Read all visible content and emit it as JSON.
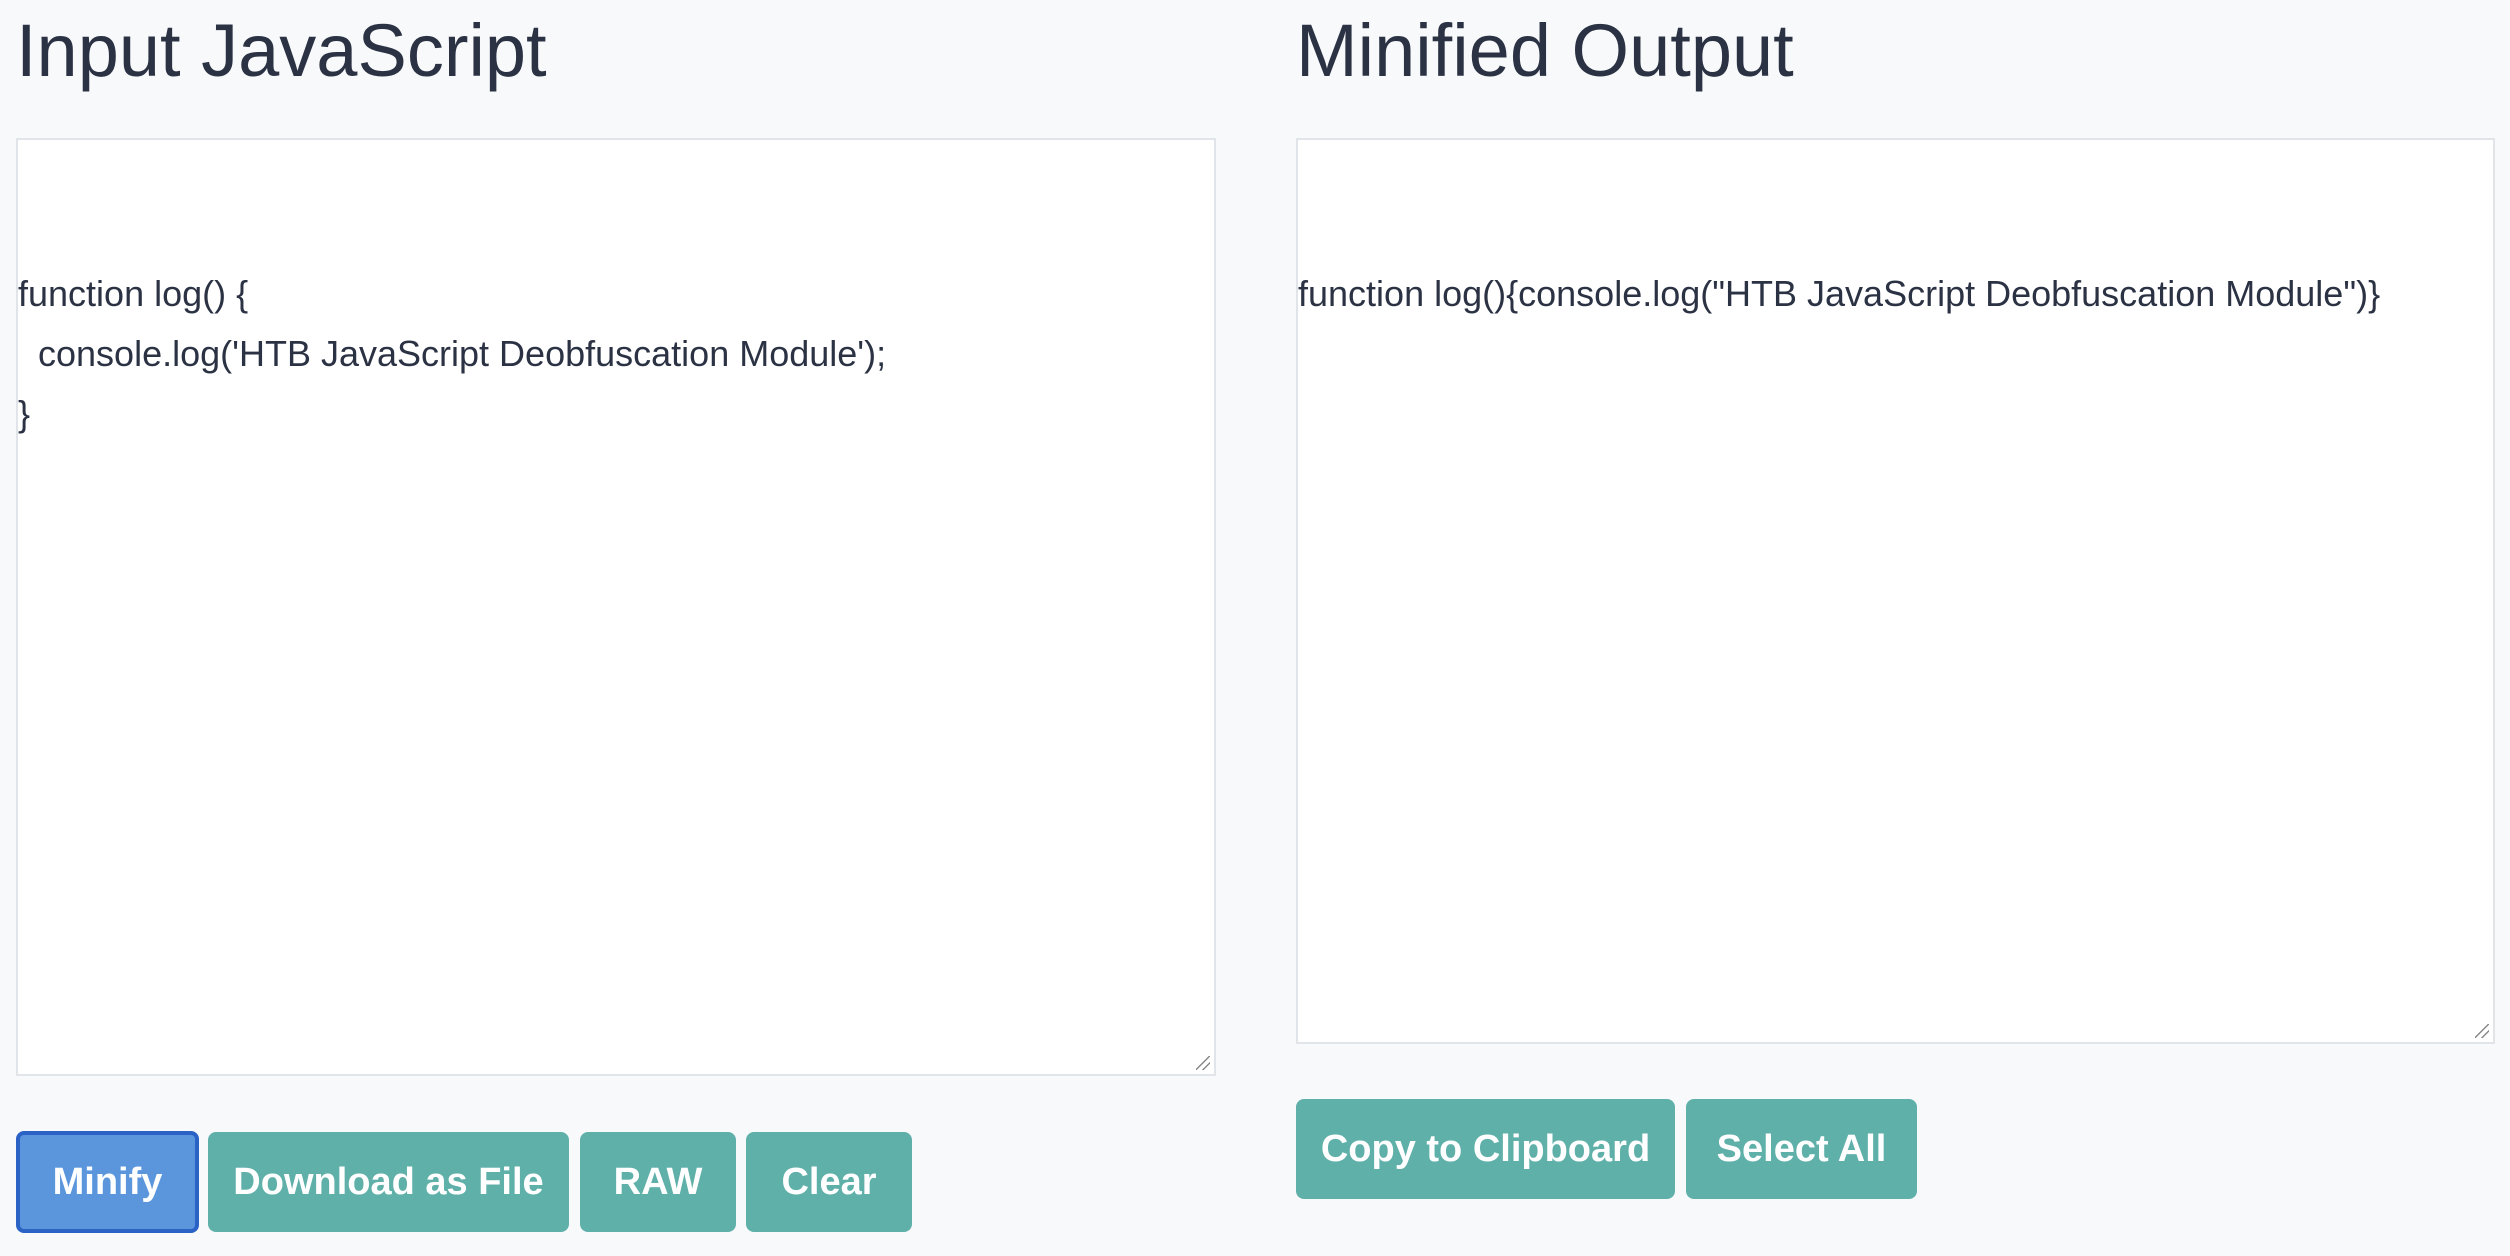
{
  "input": {
    "title": "Input JavaScript",
    "code": "function log() {\n  console.log('HTB JavaScript Deobfuscation Module');\n}",
    "buttons": {
      "minify": "Minify",
      "download": "Download as File",
      "raw": "RAW",
      "clear": "Clear"
    }
  },
  "output": {
    "title": "Minified Output",
    "code": "function log(){console.log(\"HTB JavaScript Deobfuscation Module\")}",
    "buttons": {
      "copy": "Copy to Clipboard",
      "select_all": "Select All"
    }
  }
}
